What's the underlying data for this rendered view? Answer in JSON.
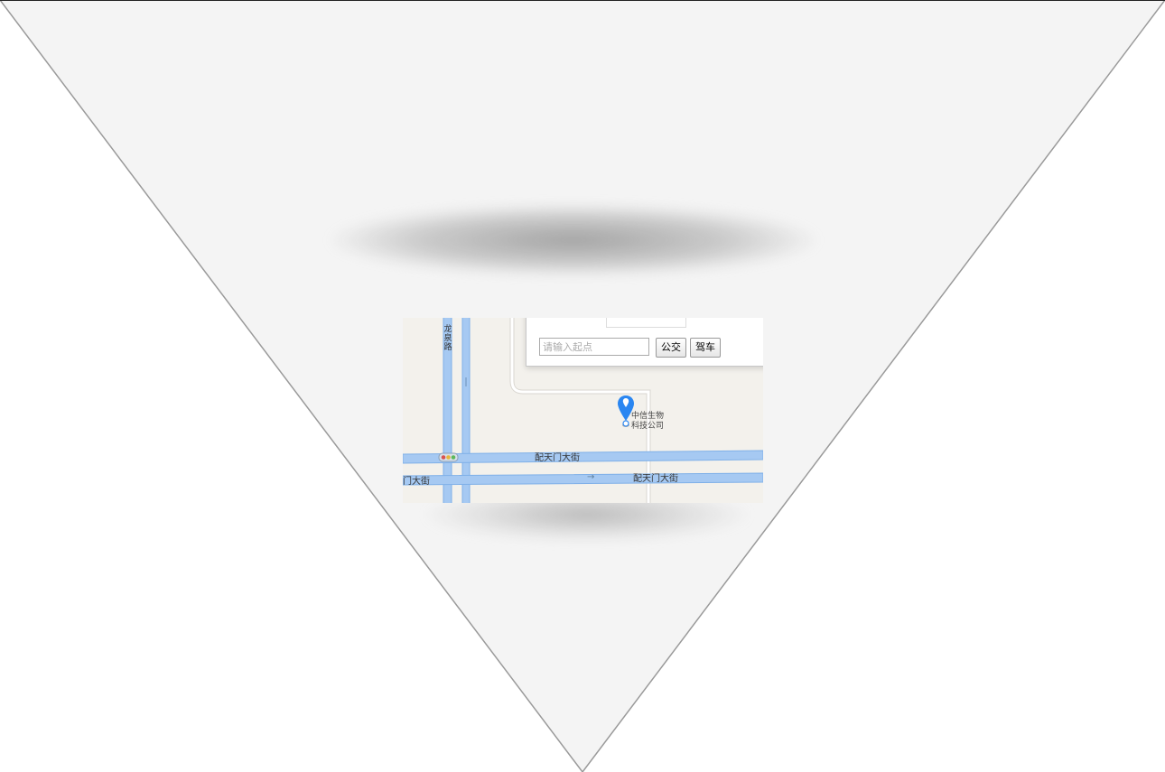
{
  "colors": {
    "triangle_fill": "#f4f4f4",
    "triangle_edge": "#9a9a9a",
    "map_background": "#f3f1ec",
    "road_blue": "#a6c9f2",
    "road_edge": "#7fb0e8",
    "marker_blue": "#2a86f1"
  },
  "map": {
    "roads": {
      "vertical_label": "龙泉路",
      "street_upper": "配天门大街",
      "street_lower_left": "门大街",
      "street_lower_right": "配天门大街",
      "arrow": "→"
    },
    "poi": {
      "name_line1": "中信生物",
      "name_line2": "科技公司",
      "marker_icon": "map-pin-icon"
    },
    "info_window": {
      "start_placeholder": "请输入起点",
      "start_value": "",
      "bus_button": "公交",
      "drive_button": "驾车"
    },
    "traffic_light_icon": "traffic-light-icon"
  }
}
